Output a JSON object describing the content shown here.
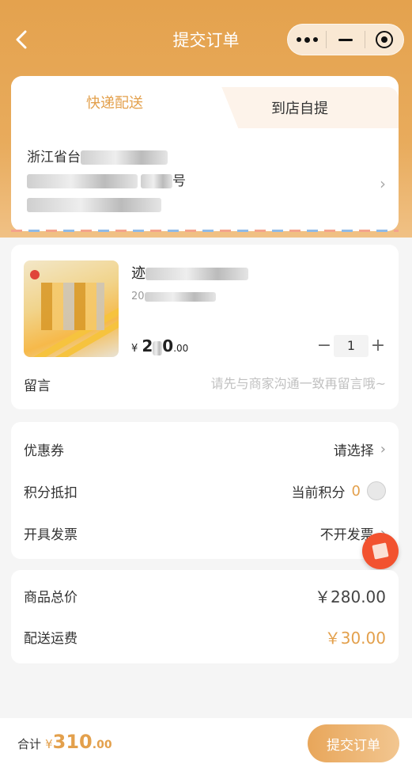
{
  "nav": {
    "title": "提交订单",
    "back_icon": "chevron-left-icon",
    "capsule": [
      "more-dots-icon",
      "minimize-icon",
      "close-target-icon"
    ]
  },
  "delivery": {
    "tabs": [
      {
        "label": "快递配送",
        "active": true
      },
      {
        "label": "到店自提",
        "active": false
      }
    ],
    "address": {
      "line1": "浙江省台",
      "line2": "号",
      "line3": ""
    }
  },
  "product": {
    "name": "迹",
    "spec": "20",
    "price_symbol": "¥",
    "price_int": "2",
    "price_int_tail": "0",
    "price_dec": ".00",
    "quantity": "1"
  },
  "note": {
    "label": "留言",
    "placeholder": "请先与商家沟通一致再留言哦~"
  },
  "options": {
    "coupon_label": "优惠券",
    "coupon_value": "请选择",
    "points_label": "积分抵扣",
    "points_text": "当前积分",
    "points_value": "0",
    "invoice_label": "开具发票",
    "invoice_value": "不开发票"
  },
  "summary": {
    "goods_label": "商品总价",
    "goods_value": "￥280.00",
    "shipping_label": "配送运费",
    "shipping_value": "￥30.00"
  },
  "footer": {
    "total_label": "合计",
    "total_symbol": "¥",
    "total_int": "310",
    "total_dec": ".00",
    "submit_label": "提交订单"
  },
  "colors": {
    "accent": "#e3a04c",
    "header": "#e4a24e",
    "float_button": "#f2522f"
  }
}
